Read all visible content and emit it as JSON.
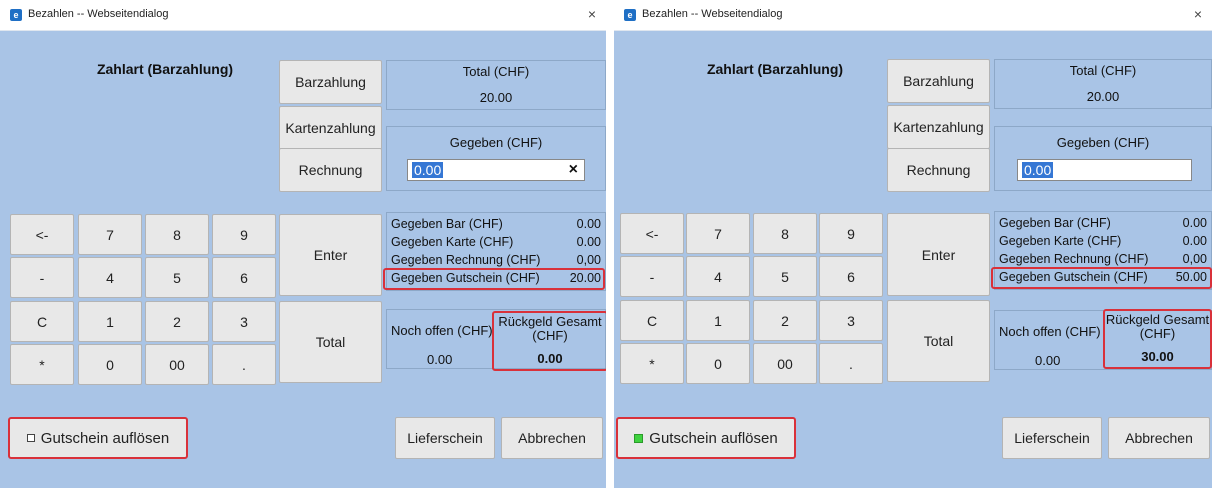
{
  "dialogs": [
    {
      "title": "Bezahlen -- Webseitendialog",
      "close": "×",
      "heading": "Zahlart (Barzahlung)",
      "pay_buttons": [
        "Barzahlung",
        "Kartenzahlung",
        "Rechnung"
      ],
      "total_label": "Total (CHF)",
      "total_value": "20.00",
      "gegeben_label": "Gegeben (CHF)",
      "gegeben_value": "0.00",
      "clear_x": "×",
      "keypad": [
        [
          "<-",
          "7",
          "8",
          "9"
        ],
        [
          "-",
          "4",
          "5",
          "6"
        ],
        [
          "C",
          "1",
          "2",
          "3"
        ],
        [
          "*",
          "0",
          "00",
          "."
        ]
      ],
      "enter_label": "Enter",
      "total_button": "Total",
      "summary": [
        {
          "label": "Gegeben Bar (CHF)",
          "value": "0.00"
        },
        {
          "label": "Gegeben Karte (CHF)",
          "value": "0.00"
        },
        {
          "label": "Gegeben Rechnung (CHF)",
          "value": "0,00"
        },
        {
          "label": "Gegeben Gutschein (CHF)",
          "value": "20.00"
        }
      ],
      "noch_offen_label": "Noch offen (CHF)",
      "noch_offen_value": "0.00",
      "rueckgeld_label": "Rückgeld Gesamt (CHF)",
      "rueckgeld_value": "0.00",
      "gutschein_button": "Gutschein auflösen",
      "gutschein_checked": false,
      "lieferschein": "Lieferschein",
      "abbrechen": "Abbrechen"
    },
    {
      "title": "Bezahlen -- Webseitendialog",
      "close": "×",
      "heading": "Zahlart (Barzahlung)",
      "pay_buttons": [
        "Barzahlung",
        "Kartenzahlung",
        "Rechnung"
      ],
      "total_label": "Total (CHF)",
      "total_value": "20.00",
      "gegeben_label": "Gegeben (CHF)",
      "gegeben_value": "0.00",
      "clear_x": "",
      "keypad": [
        [
          "<-",
          "7",
          "8",
          "9"
        ],
        [
          "-",
          "4",
          "5",
          "6"
        ],
        [
          "C",
          "1",
          "2",
          "3"
        ],
        [
          "*",
          "0",
          "00",
          "."
        ]
      ],
      "enter_label": "Enter",
      "total_button": "Total",
      "summary": [
        {
          "label": "Gegeben Bar (CHF)",
          "value": "0.00"
        },
        {
          "label": "Gegeben Karte (CHF)",
          "value": "0.00"
        },
        {
          "label": "Gegeben Rechnung (CHF)",
          "value": "0,00"
        },
        {
          "label": "Gegeben Gutschein (CHF)",
          "value": "50.00"
        }
      ],
      "noch_offen_label": "Noch offen (CHF)",
      "noch_offen_value": "0.00",
      "rueckgeld_label": "Rückgeld Gesamt (CHF)",
      "rueckgeld_value": "30.00",
      "gutschein_button": "Gutschein auflösen",
      "gutschein_checked": true,
      "lieferschein": "Lieferschein",
      "abbrechen": "Abbrechen"
    }
  ],
  "colors": {
    "background": "#a9c4e6",
    "highlight": "#d9313a",
    "checkbox_on": "#3fd23f",
    "selection": "#3577d4"
  }
}
